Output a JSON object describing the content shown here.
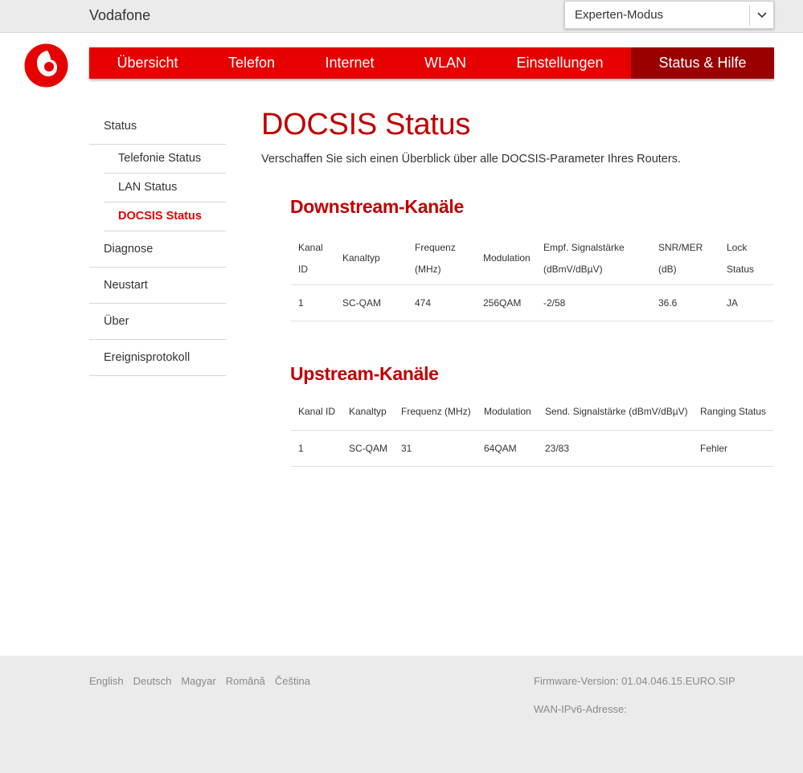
{
  "header": {
    "brand": "Vodafone",
    "mode_select": {
      "selected": "Experten-Modus"
    }
  },
  "colors": {
    "brand_red": "#e60000",
    "nav_active": "#990000",
    "heading_red": "#c00000"
  },
  "nav": {
    "items": [
      {
        "label": "Übersicht"
      },
      {
        "label": "Telefon"
      },
      {
        "label": "Internet"
      },
      {
        "label": "WLAN"
      },
      {
        "label": "Einstellungen"
      },
      {
        "label": "Status & Hilfe",
        "active": true
      }
    ]
  },
  "sidebar": {
    "status": "Status",
    "sub": [
      "Telefonie Status",
      "LAN Status",
      "DOCSIS Status"
    ],
    "items": [
      "Diagnose",
      "Neustart",
      "Über",
      "Ereignisprotokoll"
    ]
  },
  "main": {
    "title": "DOCSIS Status",
    "intro": "Verschaffen Sie sich einen Überblick über alle DOCSIS-Parameter Ihres Routers.",
    "downstream": {
      "title": "Downstream-Kanäle",
      "headers": [
        {
          "l1": "Kanal",
          "l2": "ID"
        },
        {
          "l1": "Kanaltyp"
        },
        {
          "l1": "Frequenz",
          "l2": "(MHz)"
        },
        {
          "l1": "Modulation"
        },
        {
          "l1": "Empf. Signalstärke",
          "l2": "(dBmV/dBµV)"
        },
        {
          "l1": "SNR/MER",
          "l2": "(dB)"
        },
        {
          "l1": "Lock",
          "l2": "Status"
        }
      ],
      "rows": [
        [
          "1",
          "SC-QAM",
          "474",
          "256QAM",
          "-2/58",
          "36.6",
          "JA"
        ]
      ]
    },
    "upstream": {
      "title": "Upstream-Kanäle",
      "headers": [
        "Kanal ID",
        "Kanaltyp",
        "Frequenz (MHz)",
        "Modulation",
        "Send. Signalstärke (dBmV/dBµV)",
        "Ranging Status"
      ],
      "rows": [
        [
          "1",
          "SC-QAM",
          "31",
          "64QAM",
          "23/83",
          "Fehler"
        ]
      ]
    }
  },
  "footer": {
    "languages": [
      "English",
      "Deutsch",
      "Magyar",
      "Română",
      "Čeština"
    ],
    "firmware": "Firmware-Version: 01.04.046.15.EURO.SIP",
    "wan_ipv6": "WAN-IPv6-Adresse:"
  }
}
